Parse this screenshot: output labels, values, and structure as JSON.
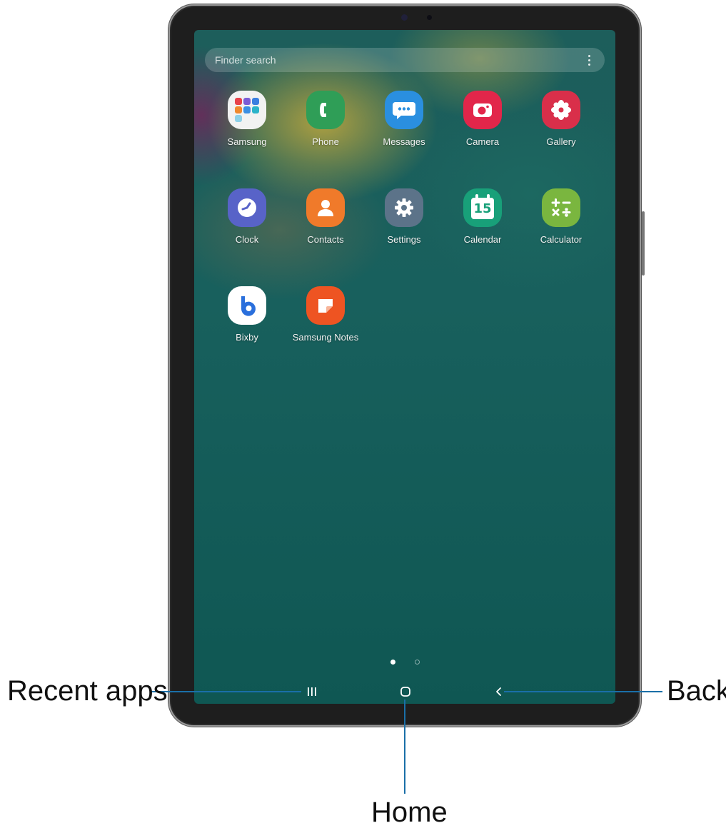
{
  "search": {
    "placeholder": "Finder search",
    "menu_icon": "more-vertical-icon"
  },
  "apps": [
    {
      "label": "Samsung",
      "icon": "samsung-folder-icon",
      "color": "#f2f2f2"
    },
    {
      "label": "Phone",
      "icon": "phone-icon",
      "color": "#2f9e57"
    },
    {
      "label": "Messages",
      "icon": "messages-icon",
      "color": "#2a8fe0"
    },
    {
      "label": "Camera",
      "icon": "camera-icon",
      "color": "#e2264a"
    },
    {
      "label": "Gallery",
      "icon": "gallery-icon",
      "color": "#d92f4a"
    },
    {
      "label": "Clock",
      "icon": "clock-icon",
      "color": "#5863c8"
    },
    {
      "label": "Contacts",
      "icon": "contacts-icon",
      "color": "#f07a2a"
    },
    {
      "label": "Settings",
      "icon": "settings-icon",
      "color": "#5c7389"
    },
    {
      "label": "Calendar",
      "icon": "calendar-icon",
      "color": "#18a079",
      "day": "15"
    },
    {
      "label": "Calculator",
      "icon": "calculator-icon",
      "color": "#7ab63f"
    },
    {
      "label": "Bixby",
      "icon": "bixby-icon",
      "color": "#ffffff"
    },
    {
      "label": "Samsung Notes",
      "icon": "samsung-notes-icon",
      "color": "#ee5422"
    }
  ],
  "page_indicator": {
    "pages": 2,
    "current": 1
  },
  "navbar": {
    "recent_icon": "recent-apps-icon",
    "home_icon": "home-icon",
    "back_icon": "back-icon"
  },
  "callouts": {
    "recent": "Recent apps",
    "home": "Home",
    "back": "Back",
    "line_color": "#1a6fa8"
  }
}
